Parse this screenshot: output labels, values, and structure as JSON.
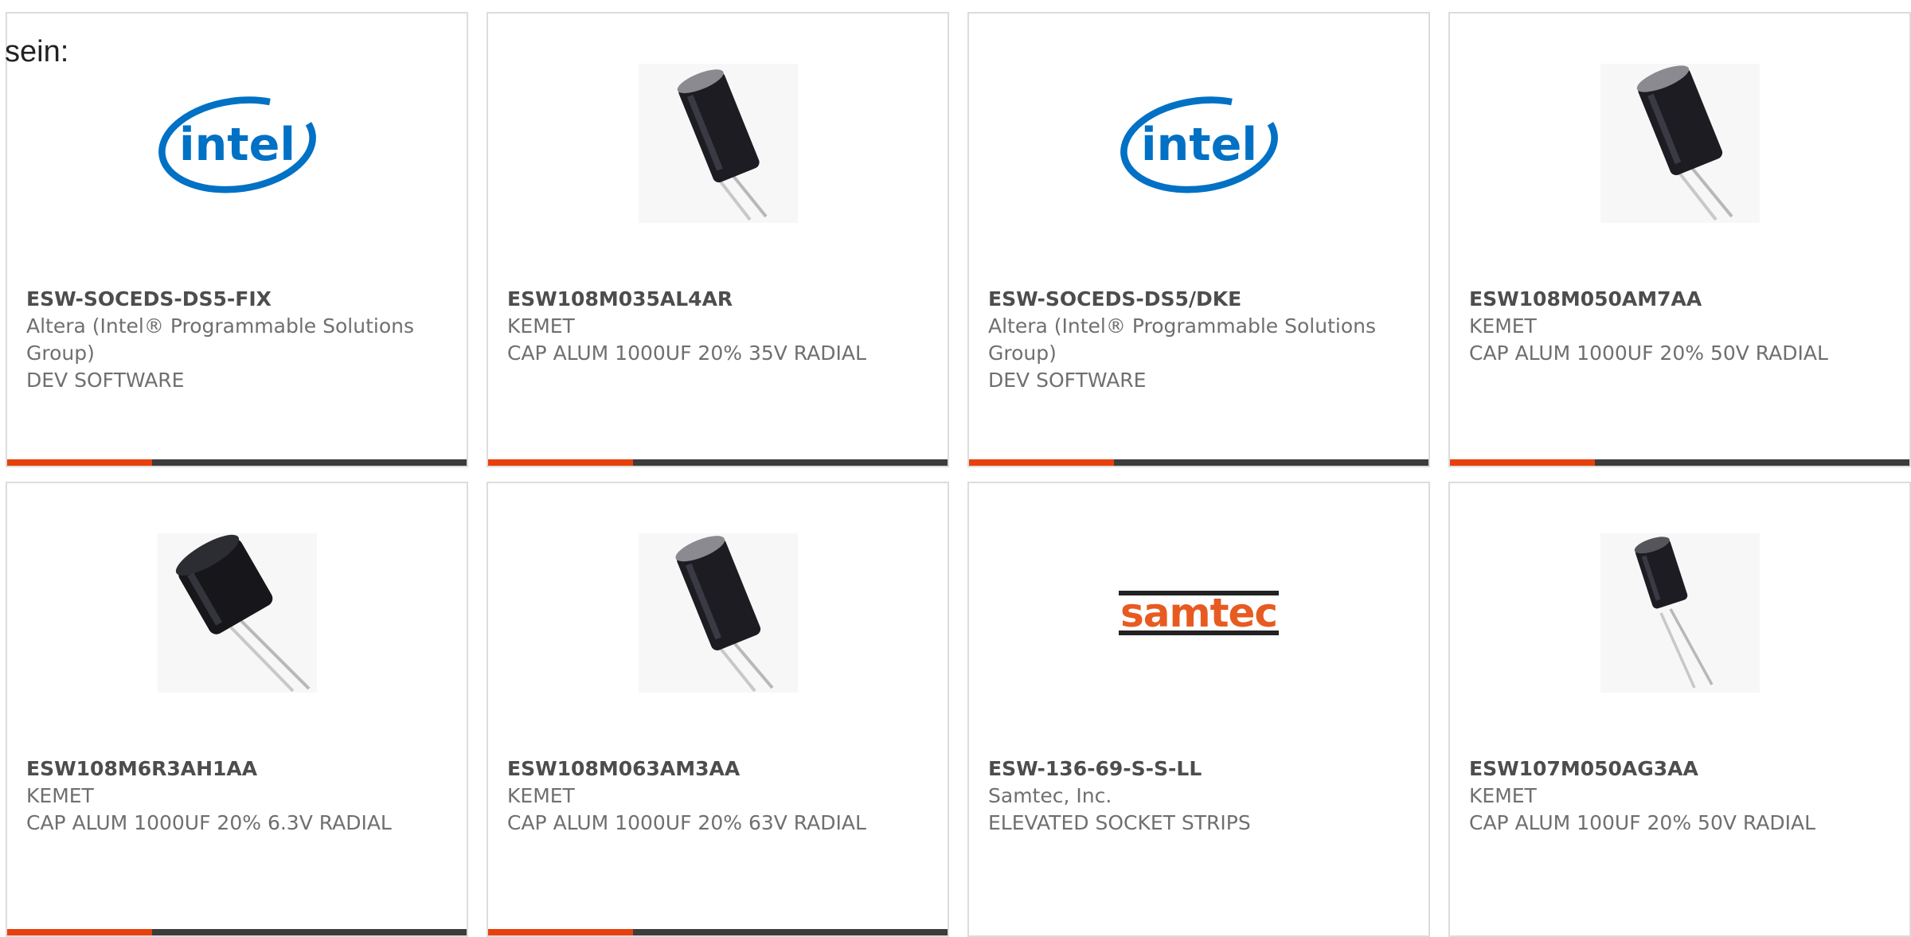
{
  "intro_text": "sein:",
  "colors": {
    "accent": "#e8400c",
    "bar": "#3c3c3c",
    "intel_blue": "#0071c5",
    "samtec_orange": "#e75b21"
  },
  "products": [
    {
      "part_number": "ESW-SOCEDS-DS5-FIX",
      "manufacturer": "Altera (Intel® Programmable Solutions Group)",
      "description": "DEV SOFTWARE",
      "image": "intel-logo",
      "logo_text": "intel"
    },
    {
      "part_number": "ESW108M035AL4AR",
      "manufacturer": "KEMET",
      "description": "CAP ALUM 1000UF 20% 35V RADIAL",
      "image": "capacitor-tall"
    },
    {
      "part_number": "ESW-SOCEDS-DS5/DKE",
      "manufacturer": "Altera (Intel® Programmable Solutions Group)",
      "description": "DEV SOFTWARE",
      "image": "intel-logo",
      "logo_text": "intel"
    },
    {
      "part_number": "ESW108M050AM7AA",
      "manufacturer": "KEMET",
      "description": "CAP ALUM 1000UF 20% 50V RADIAL",
      "image": "capacitor-tall"
    },
    {
      "part_number": "ESW108M6R3AH1AA",
      "manufacturer": "KEMET",
      "description": "CAP ALUM 1000UF 20% 6.3V RADIAL",
      "image": "capacitor-short"
    },
    {
      "part_number": "ESW108M063AM3AA",
      "manufacturer": "KEMET",
      "description": "CAP ALUM 1000UF 20% 63V RADIAL",
      "image": "capacitor-tall"
    },
    {
      "part_number": "ESW-136-69-S-S-LL",
      "manufacturer": "Samtec, Inc.",
      "description": "ELEVATED SOCKET STRIPS",
      "image": "samtec-logo",
      "logo_text": "samtec"
    },
    {
      "part_number": "ESW107M050AG3AA",
      "manufacturer": "KEMET",
      "description": "CAP ALUM 100UF 20% 50V RADIAL",
      "image": "capacitor-small"
    }
  ]
}
